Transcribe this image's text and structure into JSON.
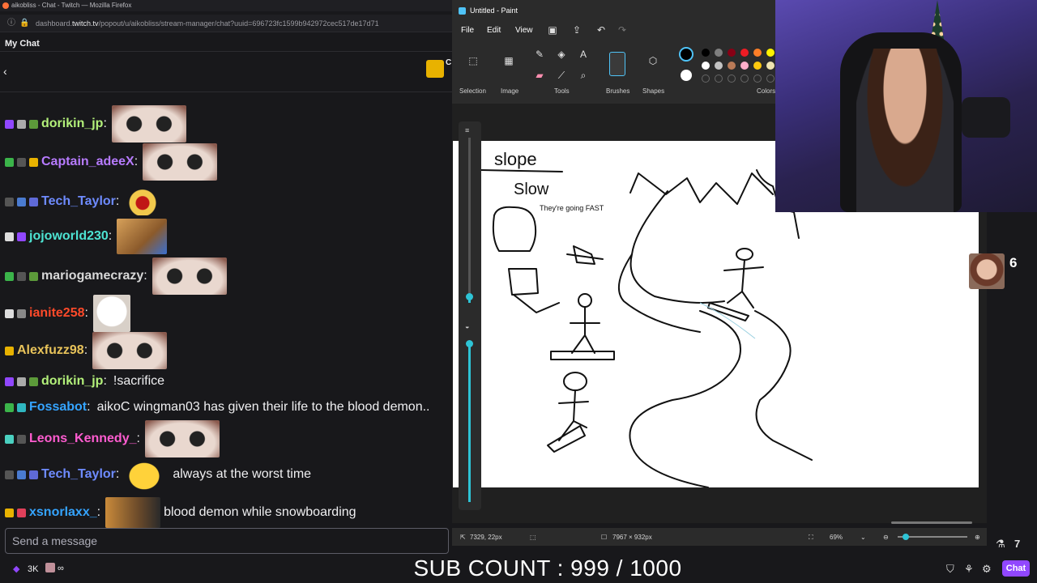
{
  "browser": {
    "title": "aikobliss - Chat - Twitch — Mozilla Firefox",
    "url_prefix": "dashboard.",
    "url_domain": "twitch.tv",
    "url_path": "/popout/u/aikobliss/stream-manager/chat?uuid=696723fc1599b942972cec517de17d71"
  },
  "chat": {
    "header": "My Chat",
    "pinned_label": "C",
    "messages": [
      {
        "user": "dorikin_jp",
        "color": "#b3f07a",
        "text": ""
      },
      {
        "user": "Captain_adeeX",
        "color": "#b77bff",
        "text": ""
      },
      {
        "user": "Tech_Taylor",
        "color": "#6e8bff",
        "text": ""
      },
      {
        "user": "jojoworld230",
        "color": "#4de3d2",
        "text": ""
      },
      {
        "user": "mariogamecrazy",
        "color": "#d8d8d8",
        "text": ""
      },
      {
        "user": "ianite258",
        "color": "#ff4a2a",
        "text": ""
      },
      {
        "user": "Alexfuzz98",
        "color": "#e8c35a",
        "text": ""
      },
      {
        "user": "dorikin_jp",
        "color": "#b3f07a",
        "text": "!sacrifice"
      },
      {
        "user": "Fossabot",
        "color": "#35a4ff",
        "text": "aikoC wingman03 has given their life to the blood demon.."
      },
      {
        "user": "Leons_Kennedy_",
        "color": "#ff5cd0",
        "text": ""
      },
      {
        "user": "Tech_Taylor",
        "color": "#6e8bff",
        "text": "always at the worst time"
      },
      {
        "user": "xsnorlaxx_",
        "color": "#35a4ff",
        "text": "blood demon while snowboarding"
      }
    ],
    "input_placeholder": "Send a message",
    "viewer_count": "3K",
    "infinity": "∞",
    "chat_button": "Chat"
  },
  "paint": {
    "title": "Untitled - Paint",
    "menu": [
      "File",
      "Edit",
      "View"
    ],
    "groups": [
      "Selection",
      "Image",
      "Tools",
      "Brushes",
      "Shapes",
      "Colors"
    ],
    "cursor_pos": "7329, 22px",
    "canvas_size": "7967 × 932px",
    "zoom": "69%",
    "swatches": [
      "#000000",
      "#7f7f7f",
      "#880015",
      "#ed1c24",
      "#ff7f27",
      "#fff200",
      "#ffffff",
      "#c3c3c3",
      "#b97a57",
      "#ffaec9",
      "#ffc90e",
      "#efe4b0"
    ],
    "drawing_text": [
      "slope",
      "Slow",
      "They're going FAST"
    ]
  },
  "overlay": {
    "sub_count": "SUB COUNT : 999 / 1000",
    "side_count": "6"
  }
}
